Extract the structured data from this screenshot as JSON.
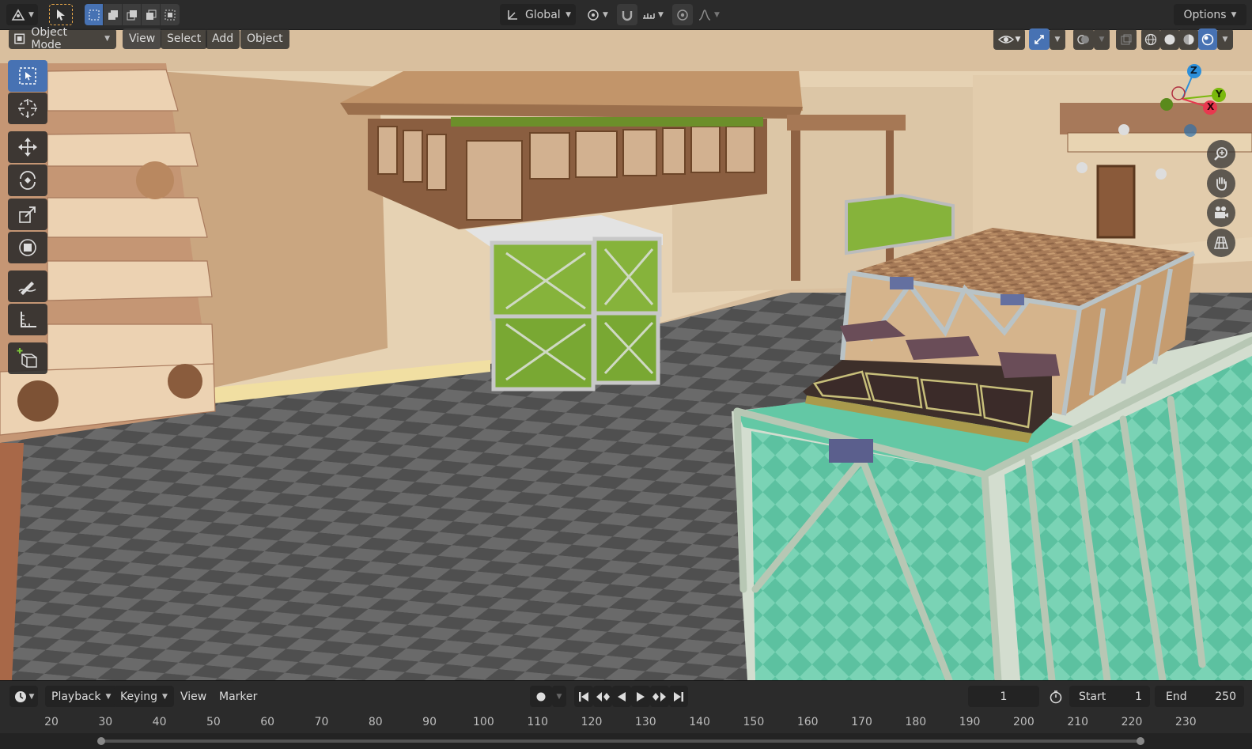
{
  "header": {
    "transform_orientation": "Global",
    "options_label": "Options"
  },
  "viewport_header": {
    "mode_label": "Object Mode",
    "menus": [
      {
        "label": "View"
      },
      {
        "label": "Select"
      },
      {
        "label": "Add"
      },
      {
        "label": "Object"
      }
    ]
  },
  "gizmo": {
    "z_label": "Z",
    "y_label": "Y",
    "x_label": "X",
    "colors": {
      "x": "#e8384f",
      "y": "#7ab80d",
      "z": "#2c8fda"
    }
  },
  "timeline": {
    "menus": [
      {
        "label": "Playback"
      },
      {
        "label": "Keying"
      },
      {
        "label": "View"
      },
      {
        "label": "Marker"
      }
    ],
    "current_frame": "1",
    "start_label": "Start",
    "start_value": "1",
    "end_label": "End",
    "end_value": "250",
    "ruler_ticks": [
      "20",
      "30",
      "40",
      "50",
      "60",
      "70",
      "80",
      "90",
      "100",
      "110",
      "120",
      "130",
      "140",
      "150",
      "160",
      "170",
      "180",
      "190",
      "200",
      "210",
      "220",
      "230"
    ]
  },
  "colors": {
    "accent": "#4772b3",
    "header_bg": "#2b2b2b"
  }
}
